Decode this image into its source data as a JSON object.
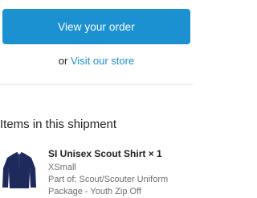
{
  "actions": {
    "view_order_label": "View your order",
    "or_text": "or",
    "visit_store_label": "Visit our store"
  },
  "shipment": {
    "section_title": "Items in this shipment",
    "items": [
      {
        "name": "SI Unisex Scout Shirt × 1",
        "variant": "XSmall",
        "package_line1": "Part of: Scout/Scouter Uniform",
        "package_line2": "Package - Youth Zip Off",
        "thumbnail_icon": "navy-long-sleeve-shirt-icon"
      }
    ]
  },
  "colors": {
    "accent": "#1b91d2",
    "shirt": "#1f2a5c"
  }
}
